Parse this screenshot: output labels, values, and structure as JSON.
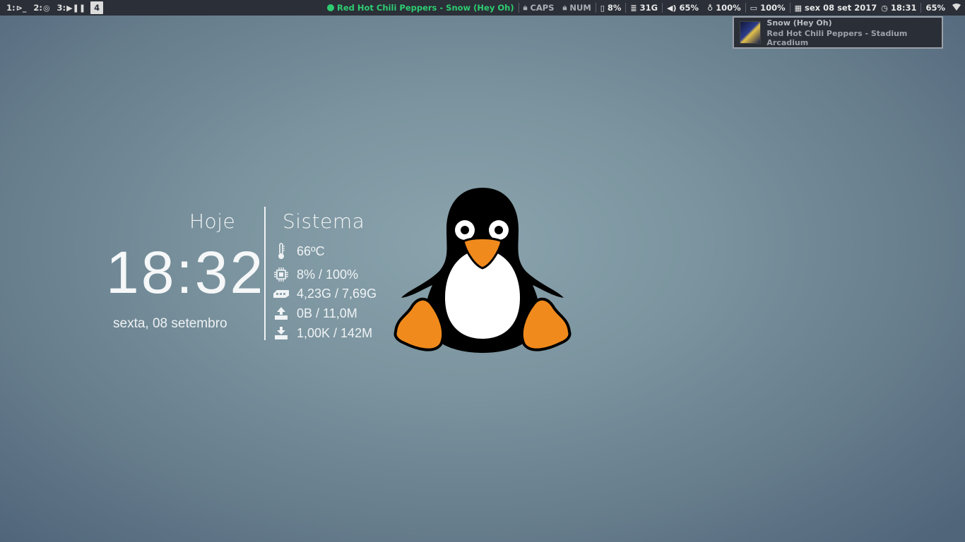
{
  "topbar": {
    "workspaces": [
      {
        "label": "1:",
        "icon": "terminal-icon",
        "glyph": "⊳_",
        "active": false
      },
      {
        "label": "2:",
        "icon": "chrome-icon",
        "glyph": "◎",
        "active": false
      },
      {
        "label": "3:",
        "icon": "media-player-icon",
        "glyph": "▶❚❚",
        "active": false
      },
      {
        "label": "4",
        "icon": "",
        "glyph": "",
        "active": true
      }
    ],
    "now_playing": "Red Hot Chili Peppers - Snow (Hey Oh)",
    "caps": "CAPS",
    "num": "NUM",
    "cpu": "8%",
    "disk": "31G",
    "volume": "65%",
    "brightness": "100%",
    "battery": "100%",
    "date": "sex 08 set 2017",
    "time": "18:31",
    "wifi": "65%",
    "colors": {
      "bar_bg": "#2b2f38",
      "spotify_green": "#2ecc71"
    }
  },
  "notification": {
    "title": "Snow (Hey Oh)",
    "body": "Red Hot Chili Peppers - Stadium Arcadium",
    "art_icon": "album-art-icon"
  },
  "widget": {
    "today_label": "Hoje",
    "time": "18:32",
    "date": "sexta, 08 setembro",
    "system_label": "Sistema",
    "temperature": "66ºC",
    "cpu": "8% / 100%",
    "memory": "4,23G / 7,69G",
    "upload": "0B  / 11,0M",
    "download": "1,00K  / 142M"
  }
}
